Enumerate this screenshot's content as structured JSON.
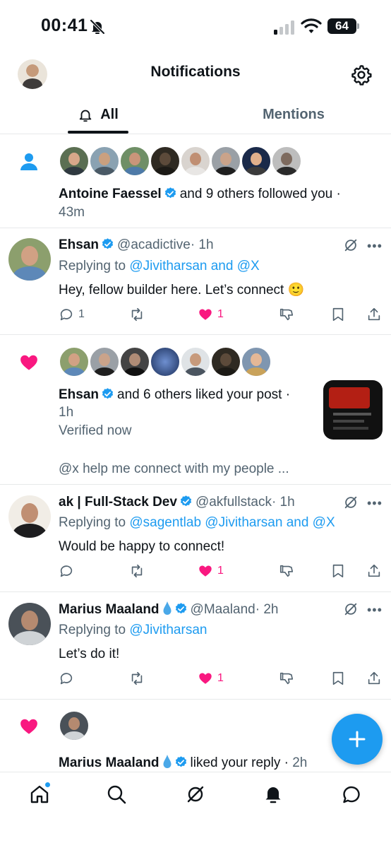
{
  "status_bar": {
    "time": "00:41",
    "battery": "64"
  },
  "header": {
    "title": "Notifications"
  },
  "tabs": [
    {
      "label": "All",
      "active": true
    },
    {
      "label": "Mentions",
      "active": false
    }
  ],
  "notifications": {
    "follow": {
      "name": "Antoine Faessel",
      "text": "and 9 others followed you ·",
      "time": "43m"
    },
    "reply1": {
      "name": "Ehsan",
      "handle": "@acadictive",
      "time": "· 1h",
      "replying_prefix": "Replying to",
      "replying_to": "@Jivitharsan and @X",
      "text": "Hey, fellow builder here. Let’s connect 🙂",
      "reply_count": "1",
      "like_count": "1"
    },
    "like1": {
      "name": "Ehsan",
      "text": "and 6 others liked your post ·",
      "time": "1h",
      "post_line1": "Verified now",
      "post_line2": "@x help me connect with my people ..."
    },
    "reply2": {
      "name": "ak | Full-Stack Dev",
      "handle": "@akfullstack",
      "time": "· 1h",
      "replying_prefix": "Replying to",
      "replying_to": "@sagentlab @Jivitharsan and @X",
      "text": "Would be happy to connect!",
      "like_count": "1"
    },
    "reply3": {
      "name": "Marius Maaland",
      "handle": "@Maaland",
      "time": "· 2h",
      "replying_prefix": "Replying to",
      "replying_to": "@Jivitharsan",
      "text": "Let’s do it!",
      "like_count": "1"
    },
    "like2": {
      "name": "Marius Maaland",
      "text": "liked your reply ·",
      "time": "2h"
    }
  },
  "colors": {
    "accent": "#1d9bf0",
    "like": "#f91880",
    "text": "#0f1419",
    "muted": "#536471"
  },
  "icons": [
    "bell-off-icon",
    "signal-icon",
    "wifi-icon",
    "battery-icon",
    "gear-icon",
    "bell-icon",
    "person-icon",
    "heart-icon",
    "verified-icon",
    "grok-icon",
    "more-icon",
    "reply-icon",
    "retweet-icon",
    "dislike-icon",
    "bookmark-icon",
    "share-icon",
    "plus-icon",
    "home-icon",
    "search-icon",
    "messages-icon"
  ]
}
